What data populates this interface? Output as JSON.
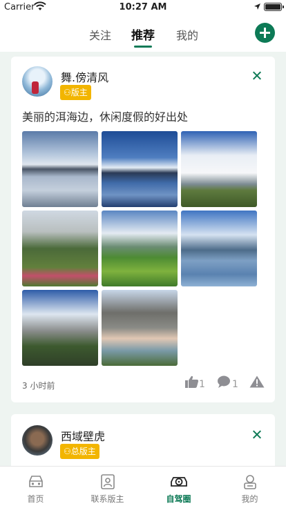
{
  "status_bar": {
    "carrier": "Carrier",
    "time": "10:27 AM"
  },
  "header": {
    "tabs": [
      {
        "label": "关注"
      },
      {
        "label": "推荐"
      },
      {
        "label": "我的"
      }
    ],
    "active_tab": "推荐"
  },
  "posts": [
    {
      "user": "舞.傍清风",
      "badge": "版主",
      "text": "美丽的洱海边，休闲度假的好出处",
      "time": "3 小时前",
      "likes": "1",
      "comments": "1",
      "photo_count": 8
    },
    {
      "user": "西域壁虎",
      "badge": "总版主"
    }
  ],
  "bottom_nav": [
    {
      "label": "首页"
    },
    {
      "label": "联系版主"
    },
    {
      "label": "自驾圈"
    },
    {
      "label": "我的"
    }
  ],
  "active_nav": "自驾圈",
  "colors": {
    "accent": "#0d7a56",
    "badge": "#f2b500"
  }
}
